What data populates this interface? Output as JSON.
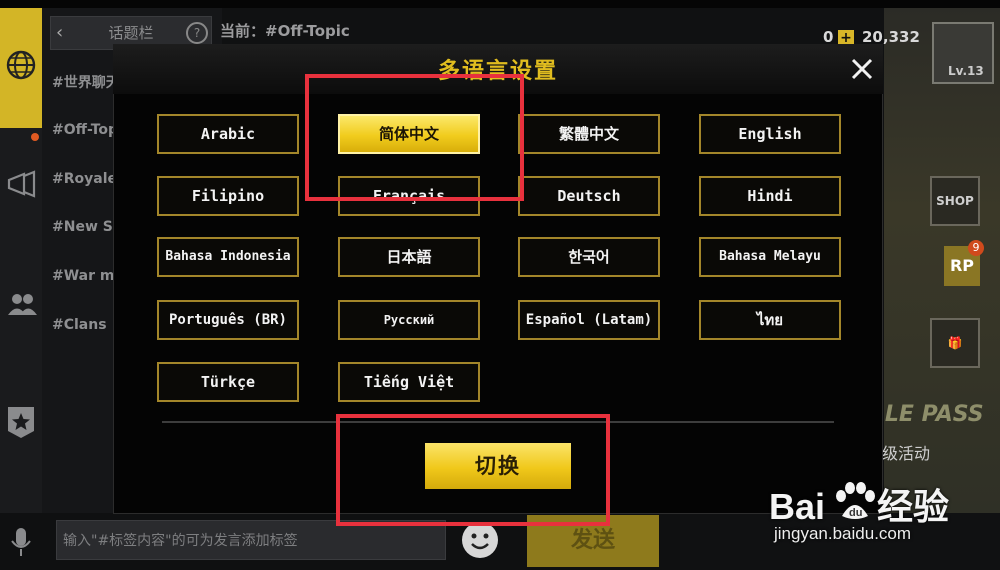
{
  "chat": {
    "header_label": "话题栏",
    "current_label": "当前：#Off-Topic",
    "topics": [
      "#世界聊天",
      "#Off-Topic",
      "#Royale Pass",
      "#New Season",
      "#War mode",
      "#Clans"
    ],
    "input_placeholder": "输入\"#标签内容\"的可为发言添加标签",
    "send_label": "发送"
  },
  "status": {
    "coins": "0",
    "currency": "20,332",
    "rank_level": "Lv.13",
    "shop_label": "SHOP",
    "rp_label": "RP",
    "rp_badge": "9",
    "royale_pass": "ROYALE PASS",
    "upgrade_label": "升级活动"
  },
  "modal": {
    "title": "多语言设置",
    "languages": [
      "Arabic",
      "简体中文",
      "繁體中文",
      "English",
      "Filipino",
      "Français",
      "Deutsch",
      "Hindi",
      "Bahasa Indonesia",
      "日本語",
      "한국어",
      "Bahasa Melayu",
      "Português (BR)",
      "Русский",
      "Español (Latam)",
      "ไทย",
      "Türkçe",
      "Tiếng Việt"
    ],
    "selected": "简体中文",
    "switch_label": "切换"
  },
  "watermark": {
    "brand": "Bai",
    "brand_suffix": "经验",
    "url": "jingyan.baidu.com"
  },
  "colors": {
    "accent_gold": "#e1bd1f",
    "annotation_red": "#e8313d"
  }
}
